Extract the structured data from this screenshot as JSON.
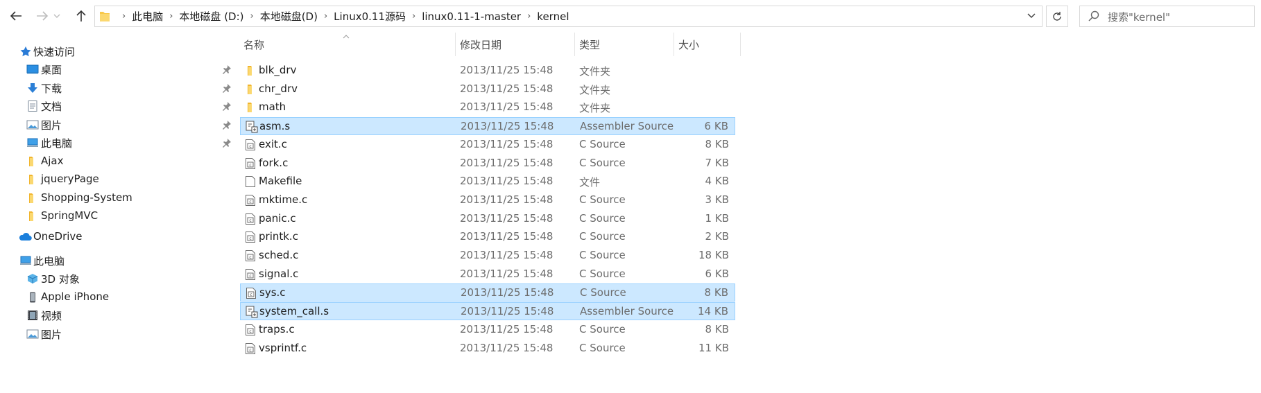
{
  "address": {
    "crumbs": [
      "此电脑",
      "本地磁盘 (D:)",
      "本地磁盘(D)",
      "Linux0.11源码",
      "linux0.11-1-master",
      "kernel"
    ]
  },
  "search": {
    "placeholder": "搜索\"kernel\""
  },
  "columns": {
    "name": "名称",
    "date": "修改日期",
    "type": "类型",
    "size": "大小"
  },
  "sidebar": {
    "quick_access": "快速访问",
    "items": [
      {
        "label": "桌面",
        "icon": "desktop-icon",
        "pinned": true
      },
      {
        "label": "下载",
        "icon": "download-icon",
        "pinned": true
      },
      {
        "label": "文档",
        "icon": "document-icon",
        "pinned": true
      },
      {
        "label": "图片",
        "icon": "picture-icon",
        "pinned": true
      },
      {
        "label": "此电脑",
        "icon": "computer-icon",
        "pinned": true
      },
      {
        "label": "Ajax",
        "icon": "folder-icon",
        "pinned": false
      },
      {
        "label": "jqueryPage",
        "icon": "folder-icon",
        "pinned": false
      },
      {
        "label": "Shopping-System",
        "icon": "folder-icon",
        "pinned": false
      },
      {
        "label": "SpringMVC",
        "icon": "folder-icon",
        "pinned": false
      }
    ],
    "onedrive": "OneDrive",
    "this_pc": "此电脑",
    "pc_items": [
      {
        "label": "3D 对象",
        "icon": "3d-objects-icon"
      },
      {
        "label": "Apple iPhone",
        "icon": "phone-icon"
      },
      {
        "label": "视频",
        "icon": "video-icon"
      },
      {
        "label": "图片",
        "icon": "picture-icon"
      }
    ]
  },
  "files": [
    {
      "name": "blk_drv",
      "date": "2013/11/25 15:48",
      "type": "文件夹",
      "size": "",
      "kind": "folder",
      "selected": false
    },
    {
      "name": "chr_drv",
      "date": "2013/11/25 15:48",
      "type": "文件夹",
      "size": "",
      "kind": "folder",
      "selected": false
    },
    {
      "name": "math",
      "date": "2013/11/25 15:48",
      "type": "文件夹",
      "size": "",
      "kind": "folder",
      "selected": false
    },
    {
      "name": "asm.s",
      "date": "2013/11/25 15:48",
      "type": "Assembler Source",
      "size": "6 KB",
      "kind": "asm",
      "selected": true
    },
    {
      "name": "exit.c",
      "date": "2013/11/25 15:48",
      "type": "C Source",
      "size": "8 KB",
      "kind": "c",
      "selected": false
    },
    {
      "name": "fork.c",
      "date": "2013/11/25 15:48",
      "type": "C Source",
      "size": "7 KB",
      "kind": "c",
      "selected": false
    },
    {
      "name": "Makefile",
      "date": "2013/11/25 15:48",
      "type": "文件",
      "size": "4 KB",
      "kind": "file",
      "selected": false
    },
    {
      "name": "mktime.c",
      "date": "2013/11/25 15:48",
      "type": "C Source",
      "size": "3 KB",
      "kind": "c",
      "selected": false
    },
    {
      "name": "panic.c",
      "date": "2013/11/25 15:48",
      "type": "C Source",
      "size": "1 KB",
      "kind": "c",
      "selected": false
    },
    {
      "name": "printk.c",
      "date": "2013/11/25 15:48",
      "type": "C Source",
      "size": "2 KB",
      "kind": "c",
      "selected": false
    },
    {
      "name": "sched.c",
      "date": "2013/11/25 15:48",
      "type": "C Source",
      "size": "18 KB",
      "kind": "c",
      "selected": false
    },
    {
      "name": "signal.c",
      "date": "2013/11/25 15:48",
      "type": "C Source",
      "size": "6 KB",
      "kind": "c",
      "selected": false
    },
    {
      "name": "sys.c",
      "date": "2013/11/25 15:48",
      "type": "C Source",
      "size": "8 KB",
      "kind": "c",
      "selected": true
    },
    {
      "name": "system_call.s",
      "date": "2013/11/25 15:48",
      "type": "Assembler Source",
      "size": "14 KB",
      "kind": "asm",
      "selected": true
    },
    {
      "name": "traps.c",
      "date": "2013/11/25 15:48",
      "type": "C Source",
      "size": "8 KB",
      "kind": "c",
      "selected": false
    },
    {
      "name": "vsprintf.c",
      "date": "2013/11/25 15:48",
      "type": "C Source",
      "size": "11 KB",
      "kind": "c",
      "selected": false
    }
  ],
  "colors": {
    "selection": "#cce8ff",
    "selection_border": "#99d1ff",
    "folder": "#f8c84a"
  }
}
